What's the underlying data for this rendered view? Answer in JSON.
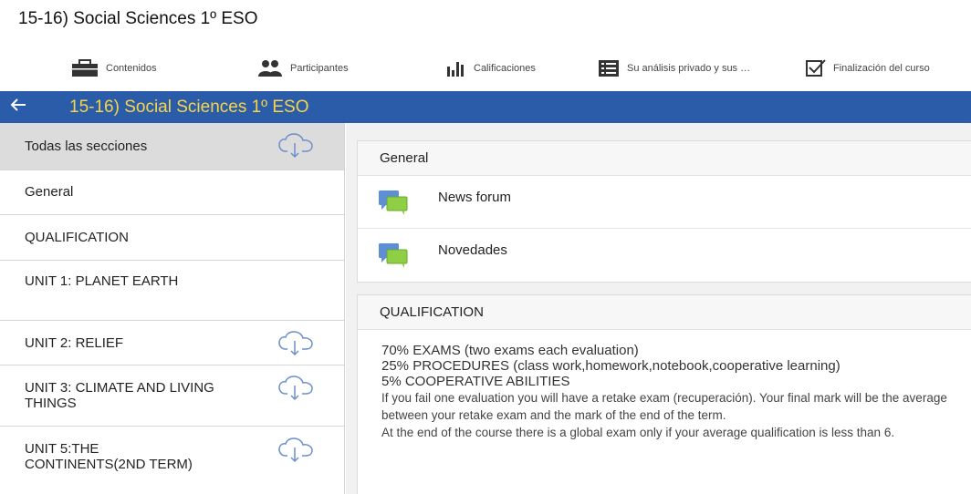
{
  "page_title": "15-16) Social Sciences 1º ESO",
  "tabs": [
    {
      "label": "Contenidos",
      "icon": "briefcase-icon"
    },
    {
      "label": "Participantes",
      "icon": "users-icon"
    },
    {
      "label": "Calificaciones",
      "icon": "bar-chart-icon"
    },
    {
      "label": "Su análisis privado y sus …",
      "icon": "list-icon"
    },
    {
      "label": "Finalización del curso",
      "icon": "checkbox-icon"
    }
  ],
  "appbar": {
    "title": "15-16) Social Sciences 1º ESO",
    "back_icon": "back-arrow-icon",
    "bg_color": "#2b5ca9",
    "title_color": "#f7d547"
  },
  "sidebar": {
    "items": [
      {
        "label": "Todas las secciones",
        "download": true,
        "active": true
      },
      {
        "label": "General",
        "download": false,
        "active": false
      },
      {
        "label": "QUALIFICATION",
        "download": false,
        "active": false
      },
      {
        "label": "UNIT 1: PLANET EARTH",
        "download": false,
        "active": false
      },
      {
        "label": "UNIT 2: RELIEF",
        "download": true,
        "active": false
      },
      {
        "label": "UNIT 3: CLIMATE AND LIVING THINGS",
        "download": true,
        "active": false
      },
      {
        "label": "UNIT 5:THE CONTINENTS(2ND TERM)",
        "download": true,
        "active": false
      }
    ]
  },
  "general_section": {
    "title": "General",
    "modules": [
      {
        "name": "News forum",
        "icon": "forum-icon"
      },
      {
        "name": "Novedades",
        "icon": "forum-icon"
      }
    ]
  },
  "qualification_section": {
    "title": "QUALIFICATION",
    "line_exams": "70% EXAMS (two exams each evaluation)",
    "line_procedures": "25% PROCEDURES (class work,homework,notebook,cooperative learning)",
    "line_cooperative": "5% COOPERATIVE ABILITIES",
    "para_retake": "If you fail one evaluation you will have a retake exam (recuperación). Your final mark will be the average between your retake exam and the mark of the end of the term.",
    "para_global": "At the end of the course there is a global exam only if your average qualification is less than 6."
  }
}
